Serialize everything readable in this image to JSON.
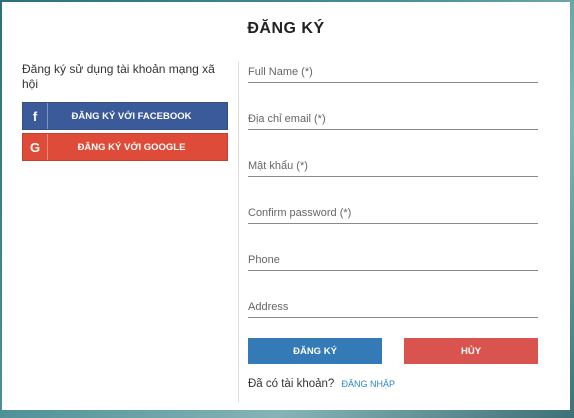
{
  "modal": {
    "title": "ĐĂNG KÝ"
  },
  "social": {
    "label": "Đăng ký sử dụng tài khoản mạng xã hội",
    "facebook": {
      "icon": "facebook-icon",
      "glyph": "f",
      "label": "ĐĂNG KÝ VỚI FACEBOOK",
      "color": "#3b5a9a"
    },
    "google": {
      "icon": "google-icon",
      "glyph": "G",
      "label": "ĐĂNG KÝ VỚI GOOGLE",
      "color": "#de4b39"
    }
  },
  "form": {
    "full_name_placeholder": "Full Name (*)",
    "email_placeholder": "Địa chỉ email (*)",
    "password_placeholder": "Mật khẩu (*)",
    "confirm_password_placeholder": "Confirm password (*)",
    "phone_placeholder": "Phone",
    "address_placeholder": "Address"
  },
  "actions": {
    "register_label": "ĐĂNG KÝ",
    "cancel_label": "HỦY",
    "register_color": "#337ab7",
    "cancel_color": "#d9534f"
  },
  "footer": {
    "have_account_text": "Đã có tài khoản?",
    "login_link": "ĐĂNG NHẬP"
  }
}
